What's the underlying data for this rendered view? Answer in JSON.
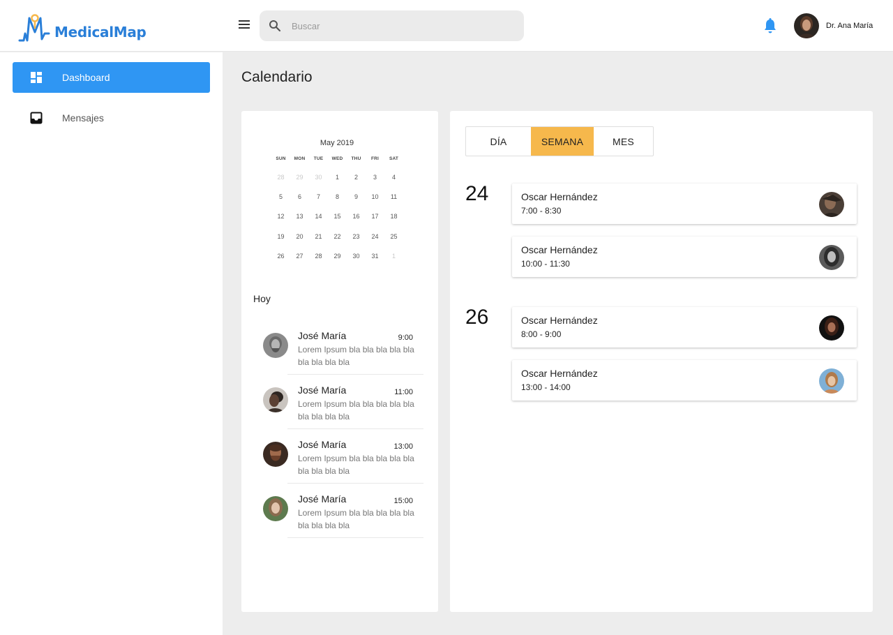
{
  "app": {
    "brand": "MedicalMap"
  },
  "header": {
    "search_placeholder": "Buscar",
    "user_name": "Dr. Ana María"
  },
  "sidebar": {
    "items": [
      {
        "label": "Dashboard",
        "icon": "dashboard-icon",
        "active": true
      },
      {
        "label": "Mensajes",
        "icon": "inbox-icon",
        "active": false
      }
    ]
  },
  "page": {
    "title": "Calendario"
  },
  "mini_calendar": {
    "month": "May 2019",
    "weekdays": [
      "SUN",
      "MON",
      "TUE",
      "WED",
      "THU",
      "FRI",
      "SAT"
    ],
    "weeks": [
      [
        "28",
        "29",
        "30",
        "1",
        "2",
        "3",
        "4"
      ],
      [
        "5",
        "6",
        "7",
        "8",
        "9",
        "10",
        "11"
      ],
      [
        "12",
        "13",
        "14",
        "15",
        "16",
        "17",
        "18"
      ],
      [
        "19",
        "20",
        "21",
        "22",
        "23",
        "24",
        "25"
      ],
      [
        "26",
        "27",
        "28",
        "29",
        "30",
        "31",
        "1"
      ]
    ]
  },
  "today": {
    "label": "Hoy",
    "messages": [
      {
        "name": "José María",
        "time": "9:00",
        "text": "Lorem Ipsum bla bla bla bla bla bla bla bla bla"
      },
      {
        "name": "José María",
        "time": "11:00",
        "text": "Lorem Ipsum bla bla bla bla bla bla bla bla bla"
      },
      {
        "name": "José María",
        "time": "13:00",
        "text": "Lorem Ipsum bla bla bla bla bla bla bla bla bla"
      },
      {
        "name": "José María",
        "time": "15:00",
        "text": "Lorem Ipsum bla bla bla bla bla bla bla bla bla"
      }
    ]
  },
  "schedule": {
    "tabs": [
      {
        "label": "DÍA",
        "active": false
      },
      {
        "label": "SEMANA",
        "active": true
      },
      {
        "label": "MES",
        "active": false
      }
    ],
    "days": [
      {
        "day": "24",
        "appointments": [
          {
            "name": "Oscar Hernández",
            "time": "7:00 - 8:30"
          },
          {
            "name": "Oscar Hernández",
            "time": "10:00 - 11:30"
          }
        ]
      },
      {
        "day": "26",
        "appointments": [
          {
            "name": "Oscar Hernández",
            "time": "8:00 - 9:00"
          },
          {
            "name": "Oscar Hernández",
            "time": "13:00 - 14:00"
          }
        ]
      }
    ]
  },
  "colors": {
    "brand_blue": "#2a7fd8",
    "active_nav": "#2f96f3",
    "active_tab": "#f6b84c",
    "bell": "#2f96f3",
    "logo_accent": "#f6b84c"
  }
}
